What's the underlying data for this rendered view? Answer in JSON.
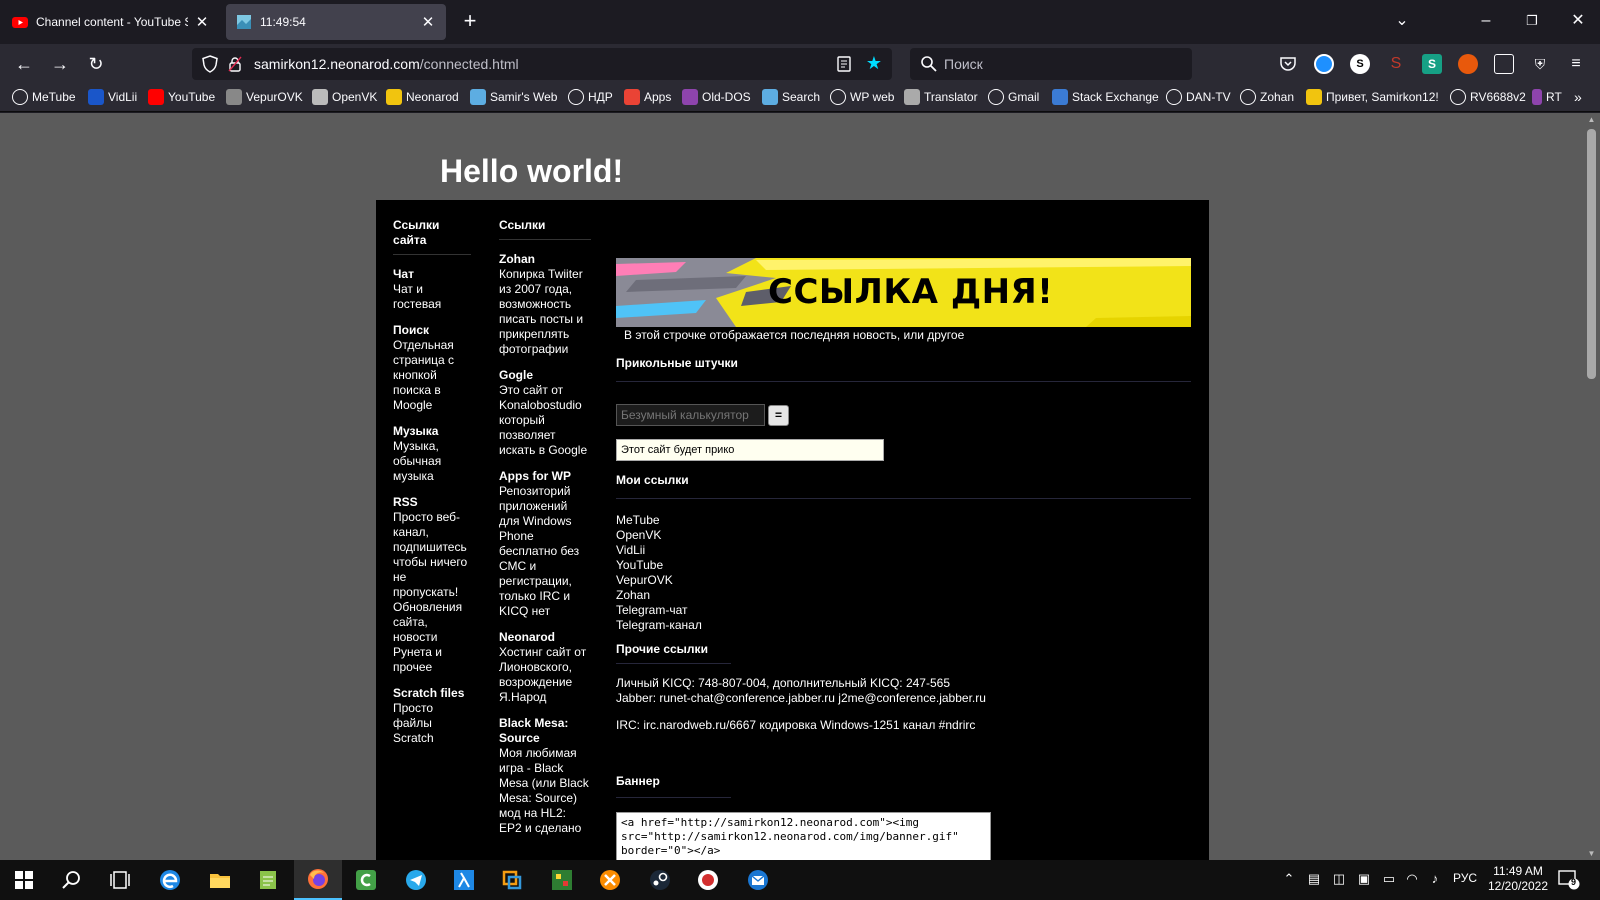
{
  "browser": {
    "tabs": [
      {
        "title": "Channel content - YouTube Studio",
        "icon": "youtube-icon",
        "active": false
      },
      {
        "title": "11:49:54",
        "icon": "page-icon",
        "active": true
      }
    ],
    "url_domain": "samirkon12.neonarod.com",
    "url_path": "/connected.html",
    "search_placeholder": "Поиск",
    "bookmarks": [
      "MeTube",
      "VidLii",
      "YouTube",
      "VepurOVK",
      "OpenVK",
      "Neonarod",
      "Samir's Web",
      "НДР",
      "Apps",
      "Old-DOS",
      "Search",
      "WP web",
      "Translator",
      "Gmail",
      "Stack Exchange",
      "DAN-TV",
      "Zohan",
      "Привет, Samirkon12!",
      "RV6688v2",
      "RT"
    ],
    "colors": {
      "accent": "#00ddff",
      "chrome_dark": "#1c1b22",
      "chrome_mid": "#2b2a33"
    }
  },
  "page": {
    "heading": "Hello world!",
    "site_links": {
      "title": "Ссылки сайта",
      "items": [
        {
          "title": "Чат",
          "desc": "Чат и гостевая"
        },
        {
          "title": "Поиск",
          "desc": "Отдельная страница с кнопкой поиска в Moogle"
        },
        {
          "title": "Музыка",
          "desc": "Музыка, обычная музыка"
        },
        {
          "title": "RSS",
          "desc": "Просто веб-канал, подпишитесь чтобы ничего не пропускать! Обновления сайта, новости Рунета и прочее"
        },
        {
          "title": "Scratch files",
          "desc": "Просто файлы Scratch"
        }
      ]
    },
    "links": {
      "title": "Ссылки",
      "items": [
        {
          "title": "Zohan",
          "desc": "Копирка Twiiter из 2007 года, возможность писать посты и прикреплять фотографии"
        },
        {
          "title": "Gogle",
          "desc": "Это сайт от Konalobostudio который позволяет искать в Google"
        },
        {
          "title": "Apps for WP",
          "desc": "Репозиторий приложений для Windows Phone бесплатно без СМС и регистрации, только IRC и KICQ нет"
        },
        {
          "title": "Neonarod",
          "desc": "Хостинг сайт от Лионовского, возрождение Я.Народ"
        },
        {
          "title": "Black Mesa: Source",
          "desc": "Моя любимая игра - Black Mesa (или Black Mesa: Source) мод на HL2: EP2 и сделано"
        }
      ]
    },
    "banner_text": "ССЫЛКА ДНЯ!",
    "news_line": "В этой строчке отображается последняя новость, или другое",
    "fun_title": "Прикольные штучки",
    "calc_placeholder": "Безумный калькулятор",
    "calc_button": "=",
    "marquee_text": "Этот сайт будет прико",
    "my_links_title": "Мои ссылки",
    "my_links": [
      "MeTube",
      "OpenVK",
      "VidLii",
      "YouTube",
      "VepurOVK",
      "Zohan",
      "Telegram-чат",
      "Telegram-канал"
    ],
    "other_title": "Прочие ссылки",
    "kicq_line": "Личный KICQ: 748-807-004, дополнительный KICQ: 247-565",
    "jabber_line": "Jabber: runet-chat@conference.jabber.ru j2me@conference.jabber.ru",
    "irc_line": "IRC: irc.narodweb.ru/6667 кодировка Windows-1251 канал #ndrirc",
    "banner_title": "Баннер",
    "banner_code": "<a href=\"http://samirkon12.neonarod.com\"><img src=\"http://samirkon12.neonarod.com/img/banner.gif\" border=\"0\"></a>"
  },
  "taskbar": {
    "lang": "РУС",
    "time": "11:49 AM",
    "date": "12/20/2022",
    "notifications": "9",
    "apps": [
      "start-icon",
      "search-icon",
      "task-view-icon",
      "edge-icon",
      "explorer-icon",
      "notepad-icon",
      "firefox-icon",
      "app-c-icon",
      "telegram-icon",
      "lambda-icon",
      "vmware-icon",
      "game-icon",
      "app-x-icon",
      "steam-icon",
      "record-icon",
      "mail-icon"
    ]
  }
}
